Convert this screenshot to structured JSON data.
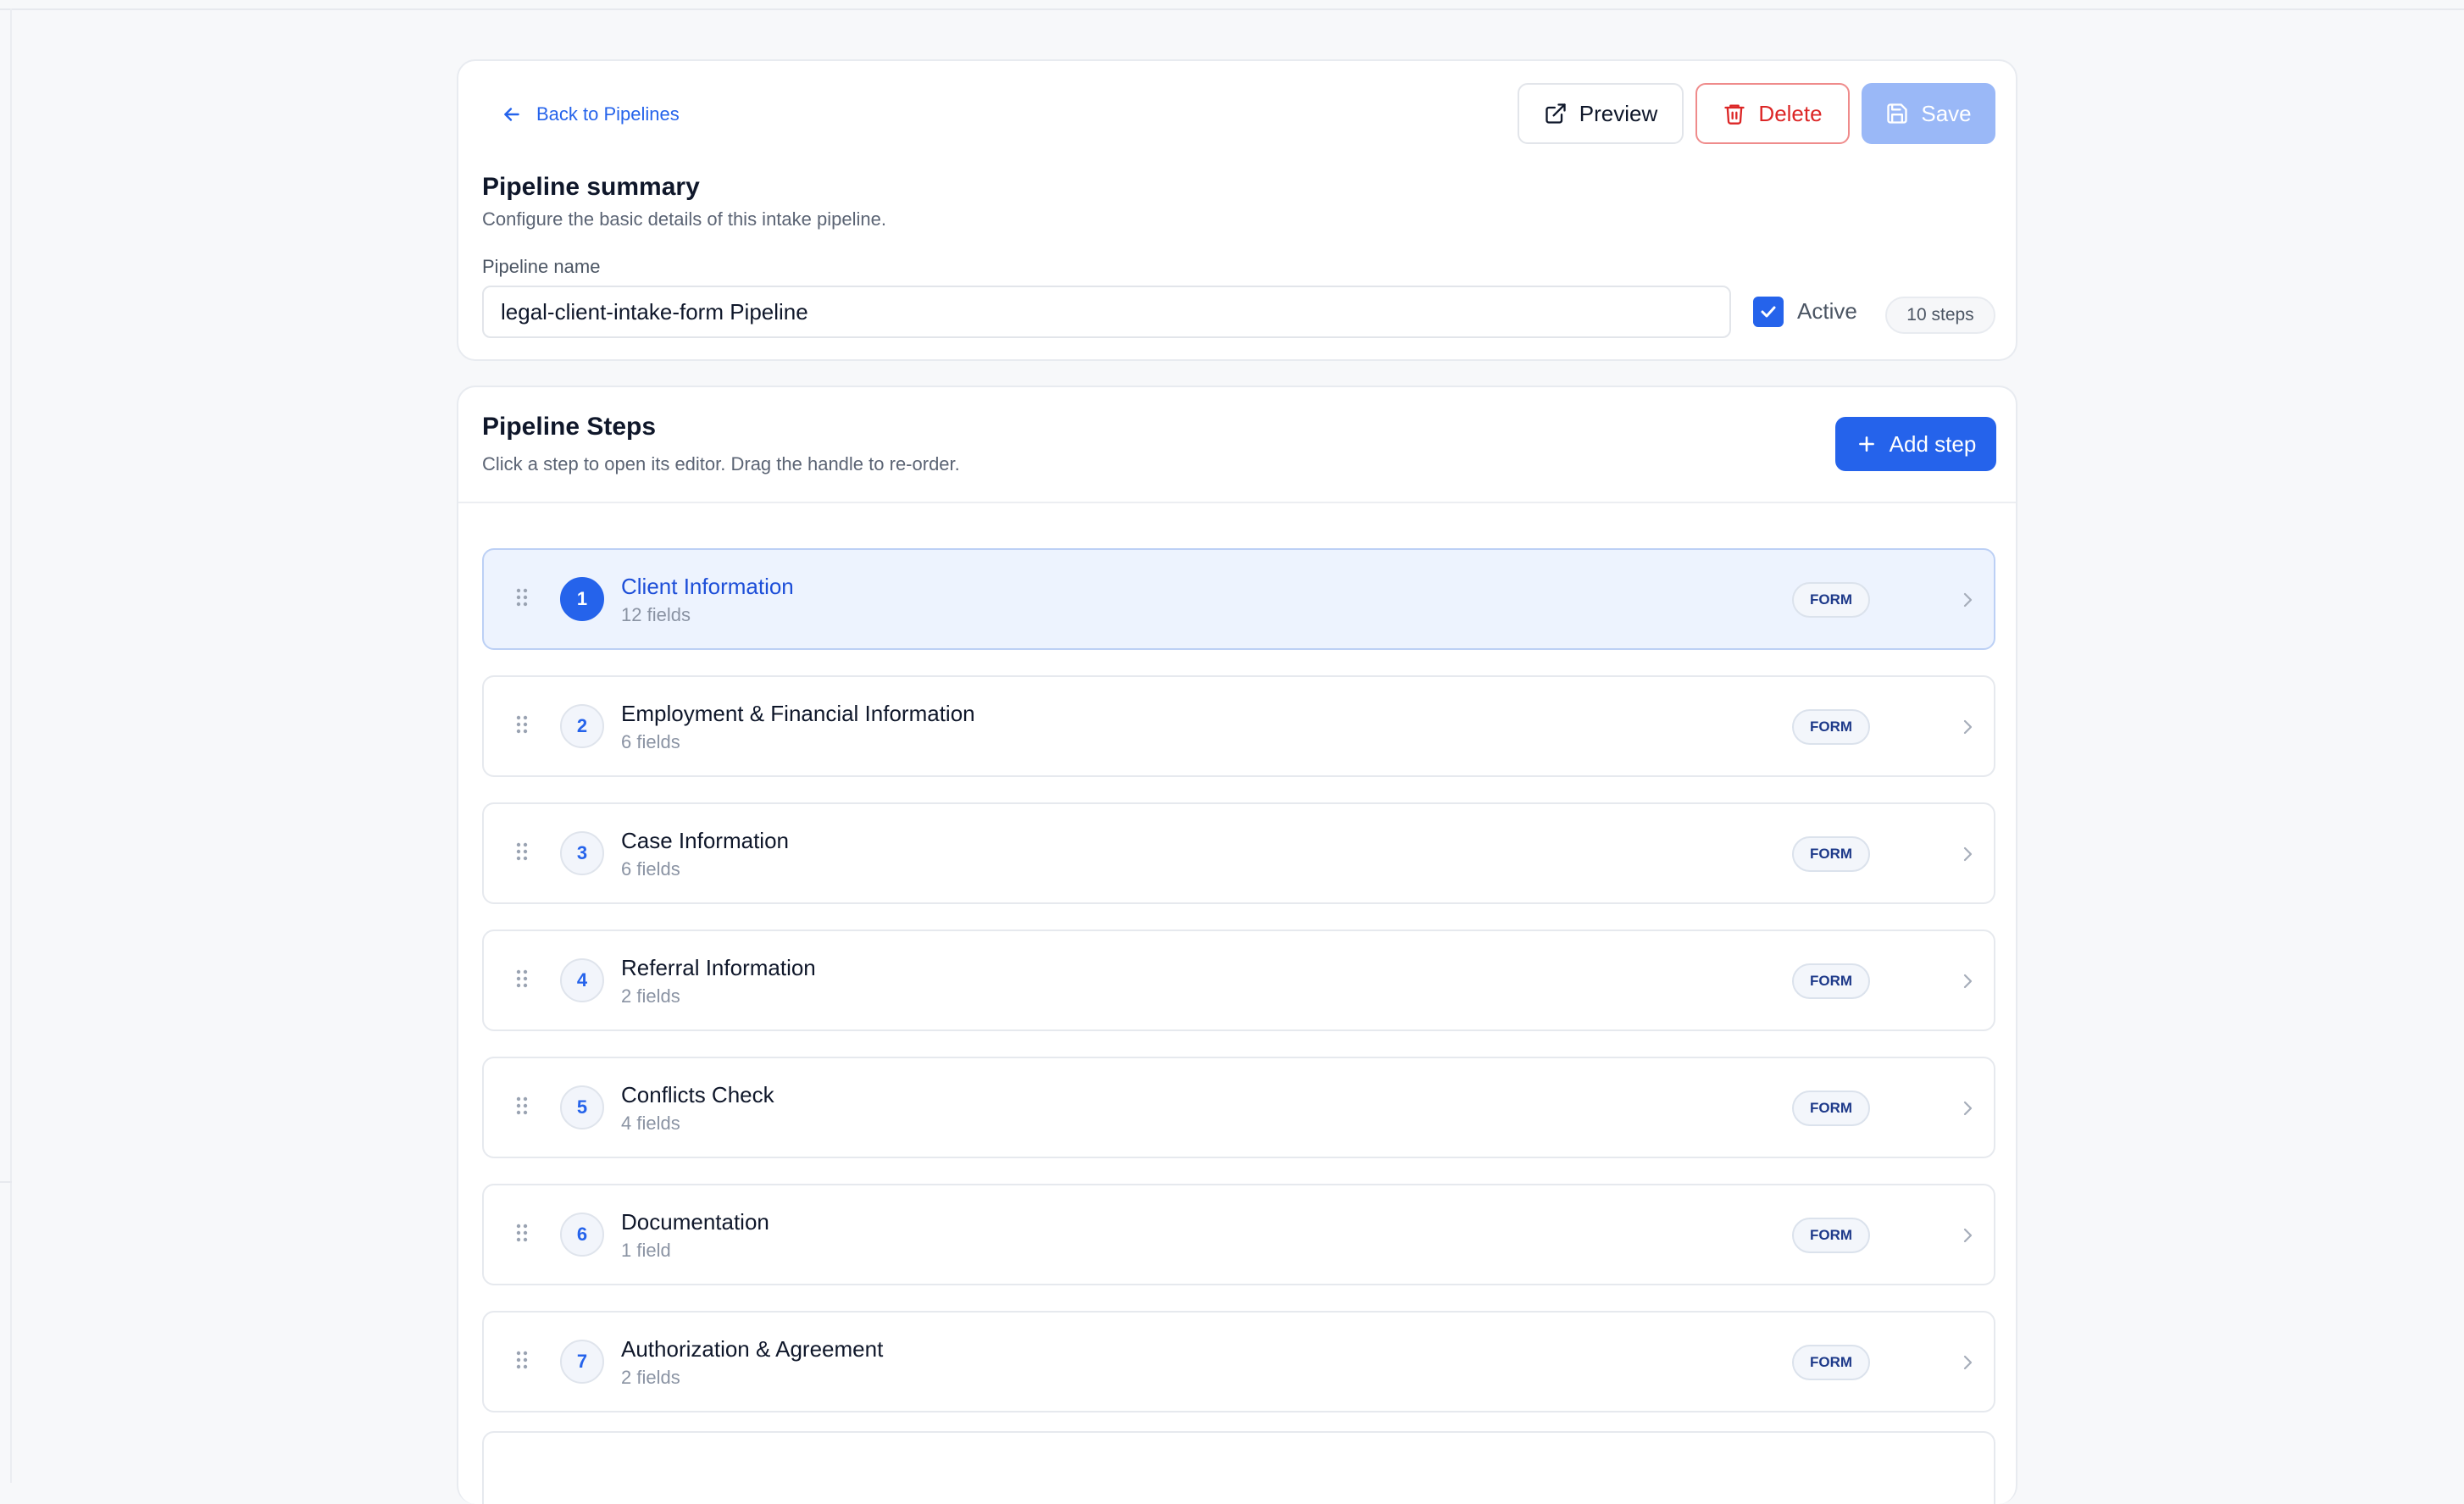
{
  "colors": {
    "accent": "#2563eb",
    "danger": "#dc2626",
    "save_disabled": "#9ab8f7",
    "selected_row": "#edf3fe"
  },
  "header": {
    "back_label": "Back to Pipelines",
    "preview_label": "Preview",
    "delete_label": "Delete",
    "save_label": "Save"
  },
  "summary": {
    "title": "Pipeline summary",
    "subtitle": "Configure the basic details of this intake pipeline.",
    "name_label": "Pipeline name",
    "name_value": "legal-client-intake-form Pipeline",
    "active_label": "Active",
    "active_checked": true,
    "steps_badge": "10 steps"
  },
  "steps_section": {
    "title": "Pipeline Steps",
    "subtitle": "Click a step to open its editor. Drag the handle to re-order.",
    "add_label": "Add step"
  },
  "steps": [
    {
      "num": "1",
      "title": "Client Information",
      "fields": "12 fields",
      "type": "FORM",
      "selected": true
    },
    {
      "num": "2",
      "title": "Employment & Financial Information",
      "fields": "6 fields",
      "type": "FORM"
    },
    {
      "num": "3",
      "title": "Case Information",
      "fields": "6 fields",
      "type": "FORM"
    },
    {
      "num": "4",
      "title": "Referral Information",
      "fields": "2 fields",
      "type": "FORM"
    },
    {
      "num": "5",
      "title": "Conflicts Check",
      "fields": "4 fields",
      "type": "FORM"
    },
    {
      "num": "6",
      "title": "Documentation",
      "fields": "1 field",
      "type": "FORM"
    },
    {
      "num": "7",
      "title": "Authorization & Agreement",
      "fields": "2 fields",
      "type": "FORM"
    }
  ]
}
